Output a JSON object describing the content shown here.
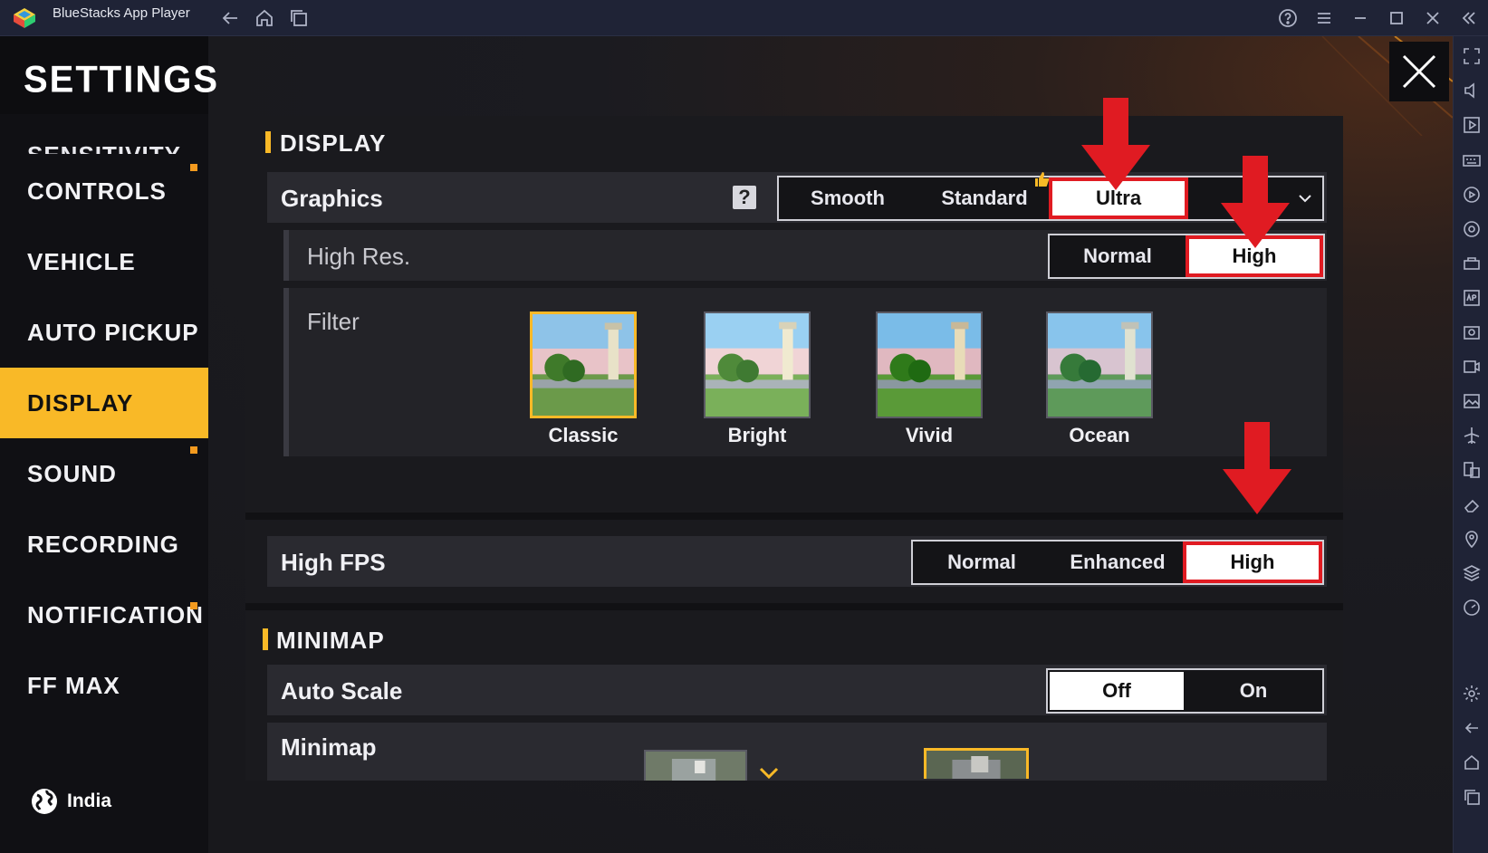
{
  "window": {
    "title": "BlueStacks App Player"
  },
  "nav": {
    "title": "SETTINGS",
    "items": [
      {
        "label": "SENSITIVITY"
      },
      {
        "label": "CONTROLS"
      },
      {
        "label": "VEHICLE"
      },
      {
        "label": "AUTO PICKUP"
      },
      {
        "label": "DISPLAY"
      },
      {
        "label": "SOUND"
      },
      {
        "label": "RECORDING"
      },
      {
        "label": "NOTIFICATION"
      },
      {
        "label": "FF MAX"
      }
    ],
    "active": "DISPLAY",
    "region": "India"
  },
  "display": {
    "title": "DISPLAY",
    "graphics": {
      "label": "Graphics",
      "help": "?",
      "options": [
        "Smooth",
        "Standard",
        "Ultra"
      ],
      "selected": "Ultra"
    },
    "high_res": {
      "label": "High Res.",
      "options": [
        "Normal",
        "High"
      ],
      "selected": "High"
    },
    "filter": {
      "label": "Filter",
      "options": [
        "Classic",
        "Bright",
        "Vivid",
        "Ocean"
      ],
      "selected": "Classic"
    },
    "high_fps": {
      "label": "High FPS",
      "options": [
        "Normal",
        "Enhanced",
        "High"
      ],
      "selected": "High"
    }
  },
  "minimap": {
    "title": "MINIMAP",
    "auto_scale": {
      "label": "Auto Scale",
      "options": [
        "Off",
        "On"
      ],
      "selected": "Off"
    },
    "minimap_label": "Minimap"
  },
  "colors": {
    "accent": "#f9b927",
    "highlight": "#e01b22",
    "titlebar": "#1f2336"
  }
}
